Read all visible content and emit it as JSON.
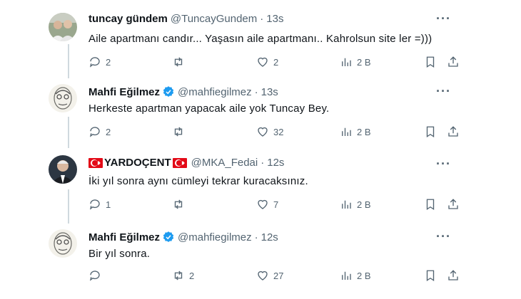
{
  "tweets": [
    {
      "name": "tuncay gündem",
      "handle": "@TuncayGundem",
      "time": "13s",
      "verified": false,
      "text": "Aile apartmanı candır... Yaşasın aile apartmanı.. Kahrolsun site ler =)))",
      "replies": "2",
      "retweets": "",
      "likes": "2",
      "views": "2 B",
      "avatar": "person-avatar-group"
    },
    {
      "name": "Mahfi Eğilmez",
      "handle": "@mahfiegilmez",
      "time": "13s",
      "verified": true,
      "text": "Herkeste apartman yapacak aile yok Tuncay Bey.",
      "replies": "2",
      "retweets": "",
      "likes": "32",
      "views": "2 B",
      "avatar": "sketch-portrait-avatar"
    },
    {
      "name": "YARDOÇENT",
      "handle": "@MKA_Fedai",
      "time": "12s",
      "verified": false,
      "flags": true,
      "text": "İki yıl sonra aynı cümleyi tekrar kuracaksınız.",
      "replies": "1",
      "retweets": "",
      "likes": "7",
      "views": "2 B",
      "avatar": "person-avatar-suit"
    },
    {
      "name": "Mahfi Eğilmez",
      "handle": "@mahfiegilmez",
      "time": "12s",
      "verified": true,
      "text": "Bir yıl sonra.",
      "replies": "",
      "retweets": "2",
      "likes": "27",
      "views": "2 B",
      "avatar": "sketch-portrait-avatar"
    }
  ],
  "ui": {
    "separator": "·",
    "more": "···",
    "colors": {
      "text": "#0f1419",
      "muted": "#536471",
      "verified": "#1d9bf0",
      "thread": "#cfd9de",
      "flag": "#e30a17"
    }
  }
}
